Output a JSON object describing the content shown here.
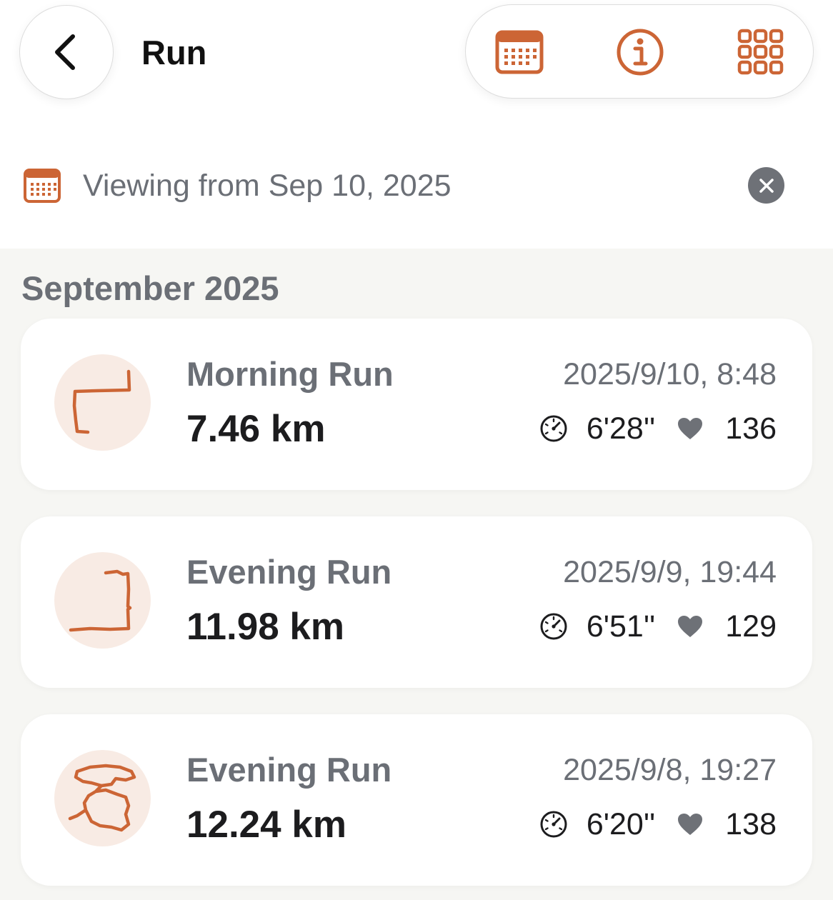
{
  "header": {
    "title": "Run",
    "icons": {
      "back": "chevron-left-icon",
      "calendar": "calendar-icon",
      "info": "info-icon",
      "grid": "grid-icon"
    }
  },
  "filter": {
    "text": "Viewing from Sep 10, 2025",
    "icon": "calendar-icon",
    "clear_icon": "close-icon"
  },
  "colors": {
    "accent": "#cc6535",
    "text_gray": "#6b6f76",
    "text_dark": "#1c1c1e",
    "list_bg": "#f6f6f3",
    "thumb_bg": "#f8ebe4"
  },
  "month_header": "September 2025",
  "activities": [
    {
      "name": "Morning Run",
      "distance": "7.46 km",
      "date": "2025/9/10, 8:48",
      "pace": "6'28''",
      "heart_rate": "136"
    },
    {
      "name": "Evening Run",
      "distance": "11.98 km",
      "date": "2025/9/9, 19:44",
      "pace": "6'51''",
      "heart_rate": "129"
    },
    {
      "name": "Evening Run",
      "distance": "12.24 km",
      "date": "2025/9/8, 19:27",
      "pace": "6'20''",
      "heart_rate": "138"
    }
  ]
}
